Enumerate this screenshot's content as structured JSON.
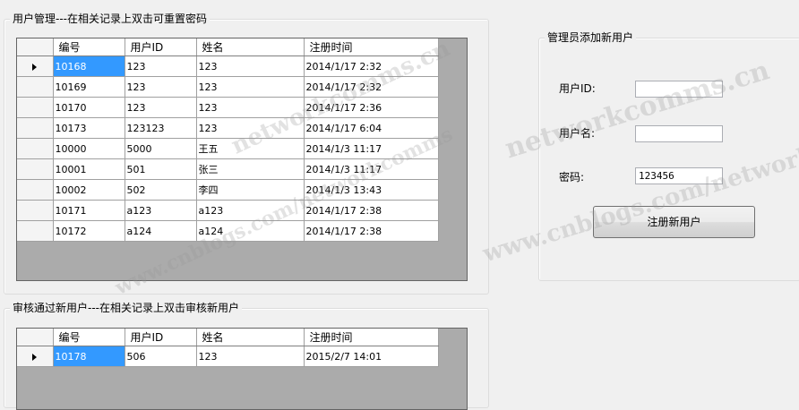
{
  "user_mgmt": {
    "title": "用户管理---在相关记录上双击可重置密码",
    "columns": [
      "编号",
      "用户ID",
      "姓名",
      "注册时间"
    ],
    "rows": [
      [
        "10168",
        "123",
        "123",
        "2014/1/17 2:32"
      ],
      [
        "10169",
        "123",
        "123",
        "2014/1/17 2:32"
      ],
      [
        "10170",
        "123",
        "123",
        "2014/1/17 2:36"
      ],
      [
        "10173",
        "123123",
        "123",
        "2014/1/17 6:04"
      ],
      [
        "10000",
        "5000",
        "王五",
        "2014/1/3 11:17"
      ],
      [
        "10001",
        "501",
        "张三",
        "2014/1/3 11:17"
      ],
      [
        "10002",
        "502",
        "李四",
        "2014/1/3 13:43"
      ],
      [
        "10171",
        "a123",
        "a123",
        "2014/1/17 2:38"
      ],
      [
        "10172",
        "a124",
        "a124",
        "2014/1/17 2:38"
      ]
    ]
  },
  "approve": {
    "title": "审核通过新用户---在相关记录上双击审核新用户",
    "columns": [
      "编号",
      "用户ID",
      "姓名",
      "注册时间"
    ],
    "rows": [
      [
        "10178",
        "506",
        "123",
        "2015/2/7 14:01"
      ]
    ]
  },
  "add_user": {
    "title": "管理员添加新用户",
    "userid_label": "用户ID:",
    "userid_value": "",
    "username_label": "用户名:",
    "username_value": "",
    "password_label": "密码:",
    "password_value": "123456",
    "register_button": "注册新用户"
  },
  "watermark": {
    "line1": "networkcomms.cn",
    "line2": "www.cnblogs.com/networkcomms"
  },
  "colors": {
    "selection": "#3399ff",
    "grid_bg": "#ababab",
    "window_bg": "#f0f0f0"
  }
}
